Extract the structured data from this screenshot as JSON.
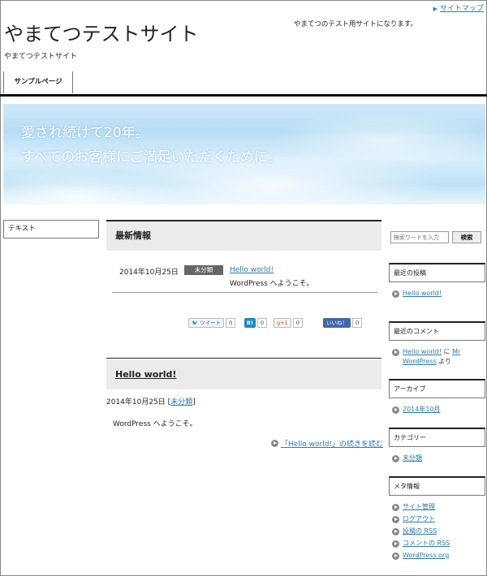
{
  "header": {
    "sitemap_label": "サイトマップ",
    "site_title": "やまてつテストサイト",
    "tagline": "やまてつテストサイト",
    "description": "やまてつのテスト用サイトになります。",
    "nav": [
      {
        "label": "サンプルページ"
      }
    ]
  },
  "banner": {
    "line1": "愛され続けて20年。",
    "line2": "すべてのお客様にご満足いただくために。"
  },
  "left_sidebar": {
    "widget_title": "テキスト"
  },
  "main": {
    "news": {
      "title": "最新情報",
      "date": "2014年10月25日",
      "category": "未分類",
      "link": "Hello world!",
      "excerpt": "WordPress へようこそ。"
    },
    "share": {
      "tweet_label": "ツイート",
      "tweet_count": "0",
      "hatena_label": "B!",
      "hatena_count": "0",
      "gplus_label": "g+1",
      "gplus_count": "0",
      "like_label": "いいね！",
      "like_count": "0"
    },
    "post": {
      "title": "Hello world!",
      "date": "2014年10月25日",
      "meta_open": " [",
      "category": "未分類",
      "meta_close": "]",
      "body": "WordPress へようこそ。",
      "readmore": "「Hello world!」の続きを読む"
    }
  },
  "right_sidebar": {
    "search": {
      "placeholder": "検索ワードを入力",
      "button_label": "検索"
    },
    "recent_posts": {
      "title": "最近の投稿",
      "items": [
        "Hello world!"
      ]
    },
    "recent_comments": {
      "title": "最近のコメント",
      "link": "Hello world!",
      "middle": " に ",
      "author": "Mr WordPress",
      "suffix": " より"
    },
    "archives": {
      "title": "アーカイブ",
      "items": [
        "2014年10月"
      ]
    },
    "categories": {
      "title": "カテゴリー",
      "items": [
        "未分類"
      ]
    },
    "meta": {
      "title": "メタ情報",
      "items": [
        "サイト管理",
        "ログアウト",
        "投稿の RSS",
        "コメントの RSS",
        "WordPress.org"
      ]
    }
  },
  "colors": {
    "link": "#2a7ab5",
    "section_bg": "#ebebeb",
    "badge_bg": "#666666"
  }
}
